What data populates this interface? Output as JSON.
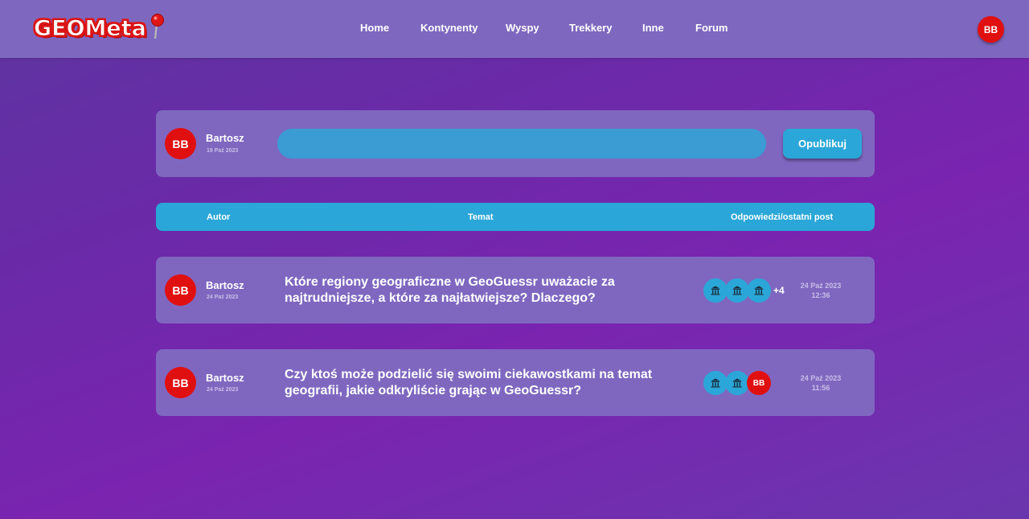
{
  "brand": {
    "name": "GEOMeta",
    "accent_color": "#e11010",
    "logo_icon": "map-pin-icon"
  },
  "nav": {
    "items": [
      {
        "label": "Home"
      },
      {
        "label": "Kontynenty"
      },
      {
        "label": "Wyspy"
      },
      {
        "label": "Trekkery"
      },
      {
        "label": "Inne"
      },
      {
        "label": "Forum"
      }
    ],
    "user_initials": "BB"
  },
  "composer": {
    "author_initials": "BB",
    "author_name": "Bartosz",
    "date": "19 Paź 2023",
    "input_value": "",
    "input_placeholder": "",
    "publish_label": "Opublikuj"
  },
  "table_header": {
    "author": "Autor",
    "topic": "Temat",
    "replies": "Odpowiedzi/ostatni post"
  },
  "topics": [
    {
      "author_initials": "BB",
      "author_name": "Bartosz",
      "date": "24 Paź 2023",
      "title": "Które regiony geograficzne w GeoGuessr uważacie za najtrudniejsze, a które za najłatwiejsze? Dlaczego?",
      "participant_icons": [
        "temple-icon",
        "temple-icon",
        "temple-icon"
      ],
      "more_count": "+4",
      "last_post_date": "24 Paź 2023",
      "last_post_time": "12:36"
    },
    {
      "author_initials": "BB",
      "author_name": "Bartosz",
      "date": "24 Paź 2023",
      "title": "Czy ktoś może podzielić się swoimi ciekawostkami na temat geografii, jakie odkryliście grając w GeoGuessr?",
      "participant_icons": [
        "temple-icon",
        "temple-icon"
      ],
      "participant_user_initials": "BB",
      "last_post_date": "24 Paź 2023",
      "last_post_time": "11:56"
    }
  ],
  "colors": {
    "navbar": "#7e68bf",
    "card": "#7f67c0",
    "accent_blue": "#2aa7d8",
    "input_blue": "#3a9cd3",
    "avatar_red": "#e11010"
  }
}
